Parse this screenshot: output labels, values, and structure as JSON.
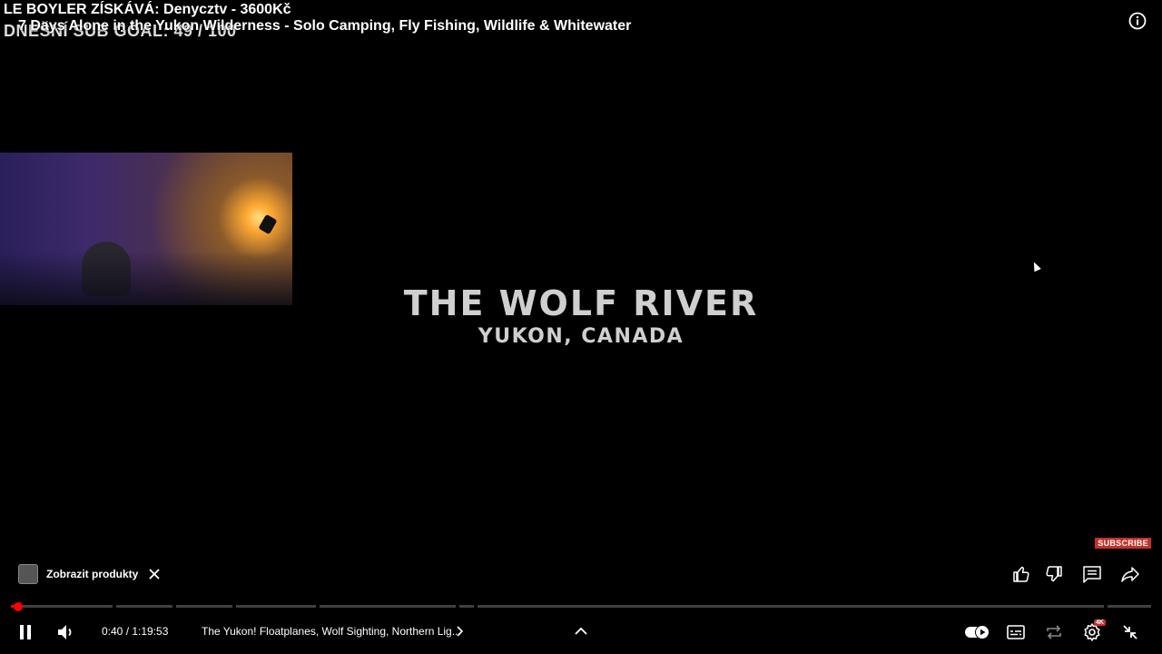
{
  "stream_overlay": {
    "line1": "LE BOYLER ZÍSKÁVÁ: Denycztv - 3600Kč",
    "line2": "DNEŠNÍ SUB GOAL: 49 / 100"
  },
  "video": {
    "title": "7 Days Alone in the Yukon Wilderness - Solo Camping, Fly Fishing, Wildlife & Whitewater",
    "on_screen_title": "THE WOLF RIVER",
    "on_screen_subtitle": "YUKON, CANADA",
    "subscribe_badge": "SUBSCRIBE"
  },
  "products": {
    "label": "Zobrazit produkty"
  },
  "player": {
    "time": "0:40 / 1:19:53",
    "chapter": "The Yukon! Floatplanes, Wolf Sighting, Northern Lig...",
    "progress_fraction": 0.0083,
    "settings_badge": "4K",
    "accent_color": "#ff0000",
    "icons": [
      "info-icon",
      "close-icon",
      "like-icon",
      "dislike-icon",
      "comments-icon",
      "share-icon",
      "pause-icon",
      "volume-icon",
      "chevron-right-icon",
      "chevron-up-icon",
      "autoplay-toggle-icon",
      "subtitles-icon",
      "repeat-icon",
      "settings-icon",
      "exit-fullscreen-icon"
    ]
  }
}
